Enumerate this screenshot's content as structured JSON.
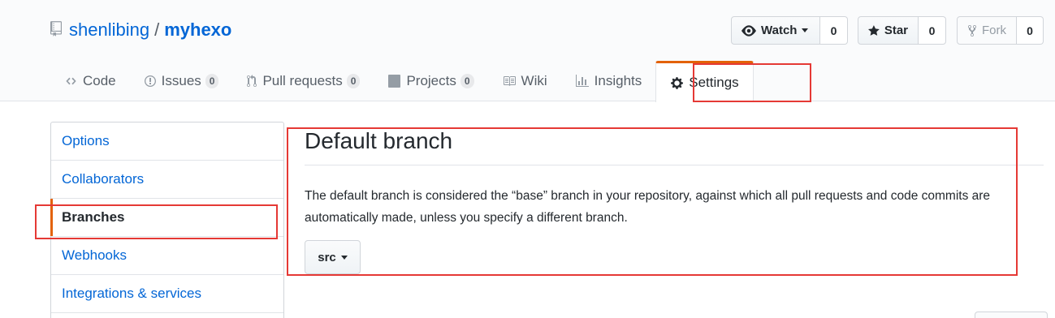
{
  "repo": {
    "owner": "shenlibing",
    "separator": "/",
    "name": "myhexo"
  },
  "actions": {
    "watch": {
      "label": "Watch",
      "count": "0"
    },
    "star": {
      "label": "Star",
      "count": "0"
    },
    "fork": {
      "label": "Fork",
      "count": "0"
    }
  },
  "tabs": [
    {
      "label": "Code",
      "icon": "code-icon"
    },
    {
      "label": "Issues",
      "count": "0",
      "icon": "issue-icon"
    },
    {
      "label": "Pull requests",
      "count": "0",
      "icon": "pull-request-icon"
    },
    {
      "label": "Projects",
      "count": "0",
      "icon": "project-icon"
    },
    {
      "label": "Wiki",
      "icon": "book-icon"
    },
    {
      "label": "Insights",
      "icon": "graph-icon"
    },
    {
      "label": "Settings",
      "icon": "gear-icon",
      "selected": true
    }
  ],
  "sidebar": {
    "items": [
      {
        "label": "Options"
      },
      {
        "label": "Collaborators"
      },
      {
        "label": "Branches",
        "selected": true
      },
      {
        "label": "Webhooks"
      },
      {
        "label": "Integrations & services"
      }
    ]
  },
  "main": {
    "heading": "Default branch",
    "description": "The default branch is considered the “base” branch in your repository, against which all pull requests and code commits are automatically made, unless you specify a different branch.",
    "branch": "src"
  },
  "colors": {
    "link": "#0366d6",
    "accent": "#e36209",
    "highlight": "#e53935"
  }
}
